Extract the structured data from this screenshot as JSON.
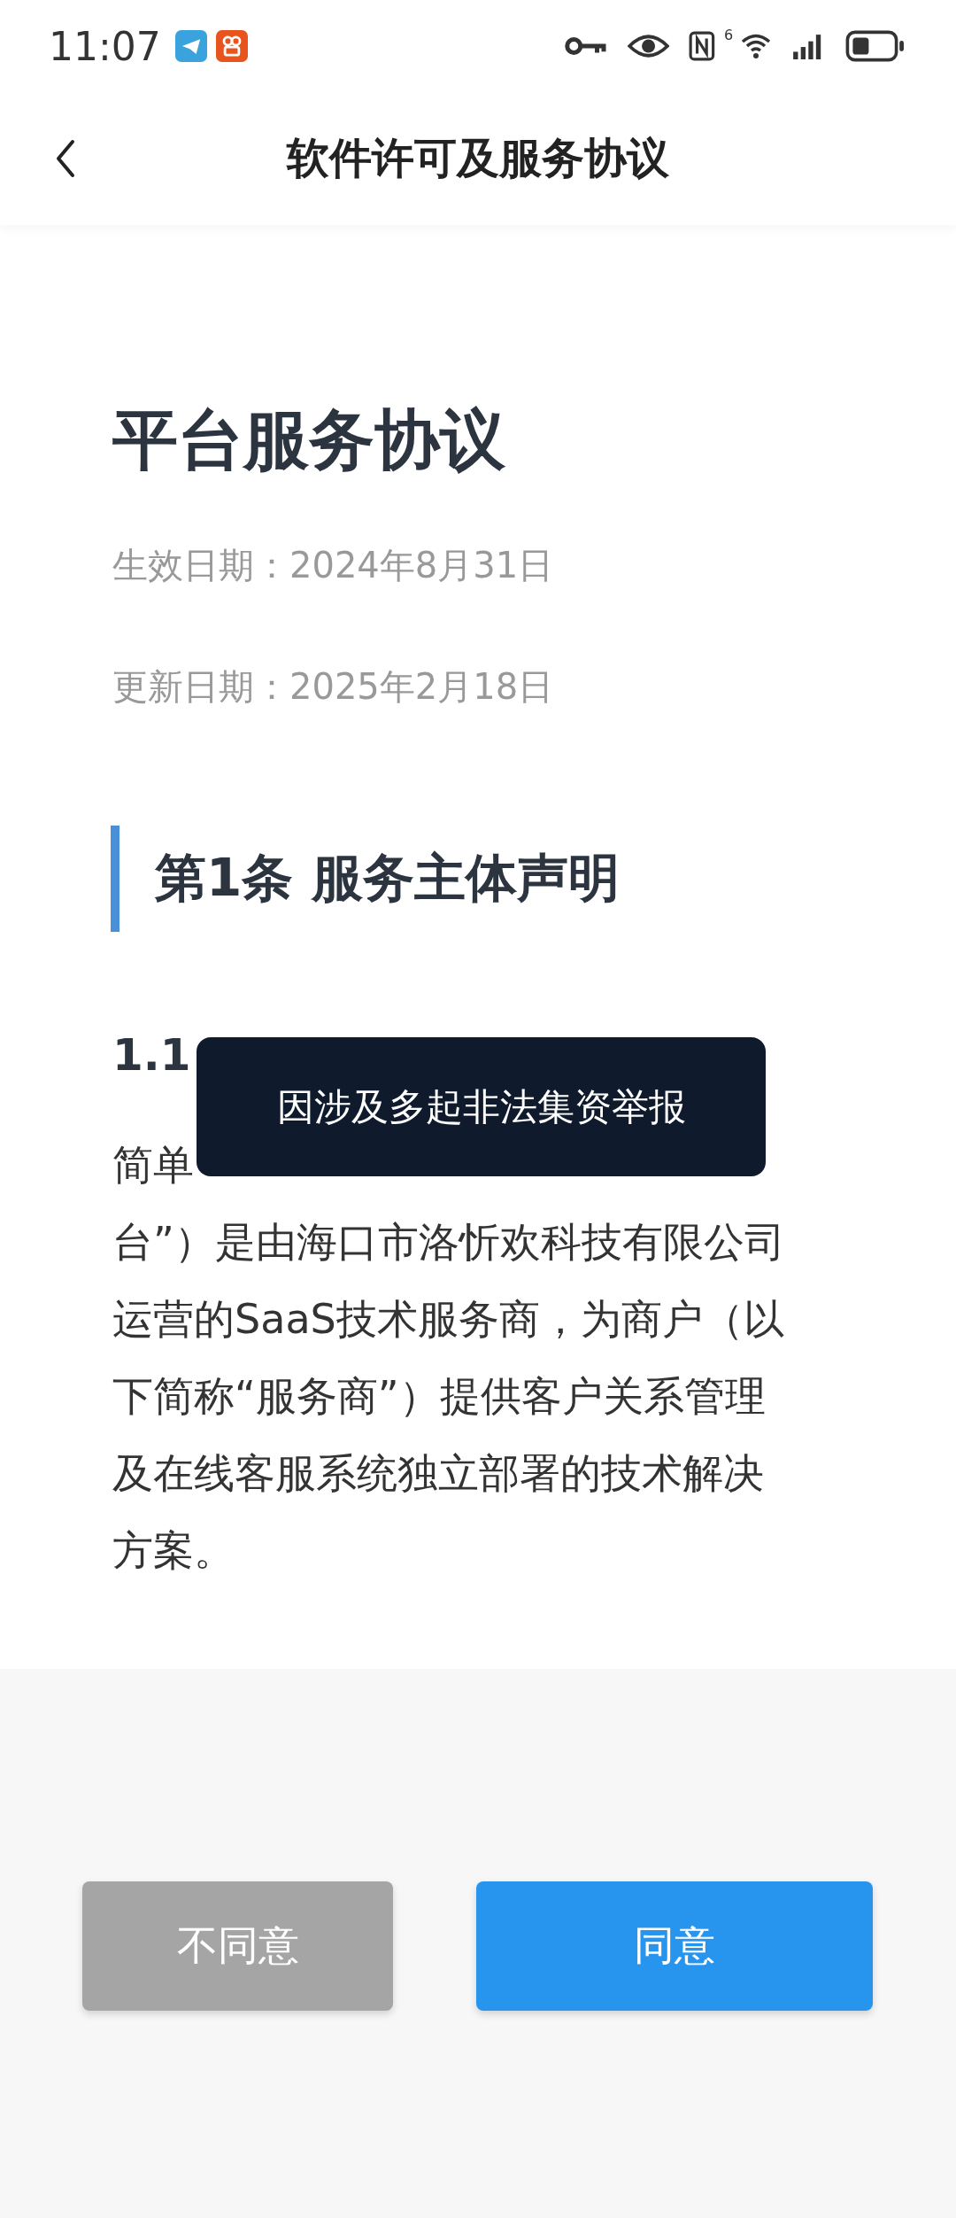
{
  "status_bar": {
    "time": "11:07",
    "signal_badge": "6"
  },
  "header": {
    "title": "软件许可及服务协议"
  },
  "document": {
    "title": "平台服务协议",
    "dates": [
      "生效日期：2024年8月31日",
      "更新日期：2025年2月18日"
    ],
    "section_title": "第1条 服务主体声明",
    "subsection_title": "1.1",
    "paragraph_lines": [
      "简单",
      "台”）是由海口市洛忻欢科技有限公司",
      "运营的SaaS技术服务商，为商户（以",
      "下简称“服务商”）提供客户关系管理",
      "及在线客服系统独立部署的技术解决",
      "方案。"
    ]
  },
  "toast": {
    "text": "因涉及多起非法集资举报"
  },
  "buttons": [
    {
      "label": "不同意",
      "kind": "decline"
    },
    {
      "label": "同意",
      "kind": "accept"
    }
  ]
}
